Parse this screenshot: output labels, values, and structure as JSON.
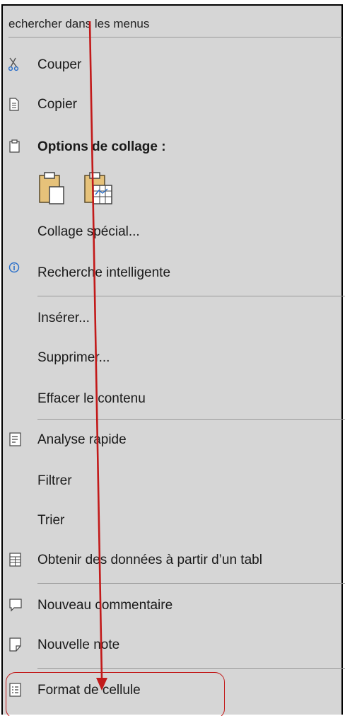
{
  "search": {
    "placeholder": "echercher dans les menus"
  },
  "menu": {
    "cut": "Couper",
    "copy": "Copier",
    "paste_options": "Options de collage :",
    "paste_special": "Collage spécial...",
    "smart_lookup": "Recherche intelligente",
    "insert": "Insérer...",
    "delete": "Supprimer...",
    "clear_contents": "Effacer le contenu",
    "quick_analysis": "Analyse rapide",
    "filter": "Filtrer",
    "sort": "Trier",
    "get_data": "Obtenir des données à partir d’un tabl",
    "new_comment": "Nouveau commentaire",
    "new_note": "Nouvelle note",
    "format_cells": "Format de cellule"
  },
  "icons": {
    "cut": "scissors-icon",
    "copy": "copy-icon",
    "paste_options": "clipboard-icon",
    "paste": "paste-icon",
    "paste_formatting": "paste-formatting-icon",
    "smart_lookup": "info-icon",
    "quick_analysis": "quick-analysis-icon",
    "get_data": "table-icon",
    "new_comment": "comment-icon",
    "new_note": "note-icon",
    "format_cells": "format-cells-icon"
  },
  "colors": {
    "menu_background": "#d6d6d6",
    "annotation": "#c21a1a",
    "text": "#1a1a1a"
  }
}
